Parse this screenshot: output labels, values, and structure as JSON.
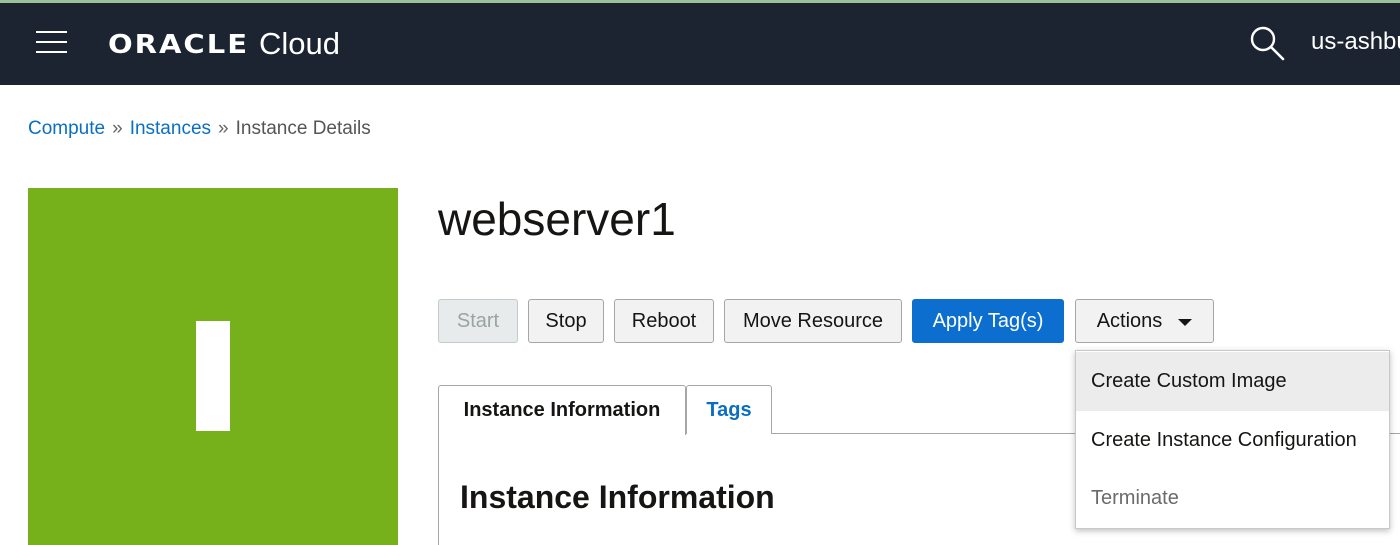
{
  "header": {
    "brand": "ORACLE",
    "product": "Cloud",
    "region": "us-ashbu",
    "icons": {
      "menu": "hamburger-menu-icon",
      "search": "search-icon"
    }
  },
  "breadcrumb": {
    "items": [
      "Compute",
      "Instances",
      "Instance Details"
    ],
    "separator": "»"
  },
  "instance": {
    "avatar_letter": "I",
    "avatar_color": "#76b11b",
    "name": "webserver1"
  },
  "actions_bar": {
    "start": "Start",
    "stop": "Stop",
    "reboot": "Reboot",
    "move_resource": "Move Resource",
    "apply_tags": "Apply Tag(s)",
    "actions": "Actions"
  },
  "actions_menu": {
    "items": [
      "Create Custom Image",
      "Create Instance Configuration",
      "Terminate"
    ]
  },
  "tabs": [
    {
      "label": "Instance Information",
      "active": true
    },
    {
      "label": "Tags",
      "active": false
    }
  ],
  "section": {
    "title": "Instance Information"
  },
  "colors": {
    "topbar": "#1c2431",
    "link": "#0a6fc2",
    "primary_button": "#0c6fcf"
  }
}
